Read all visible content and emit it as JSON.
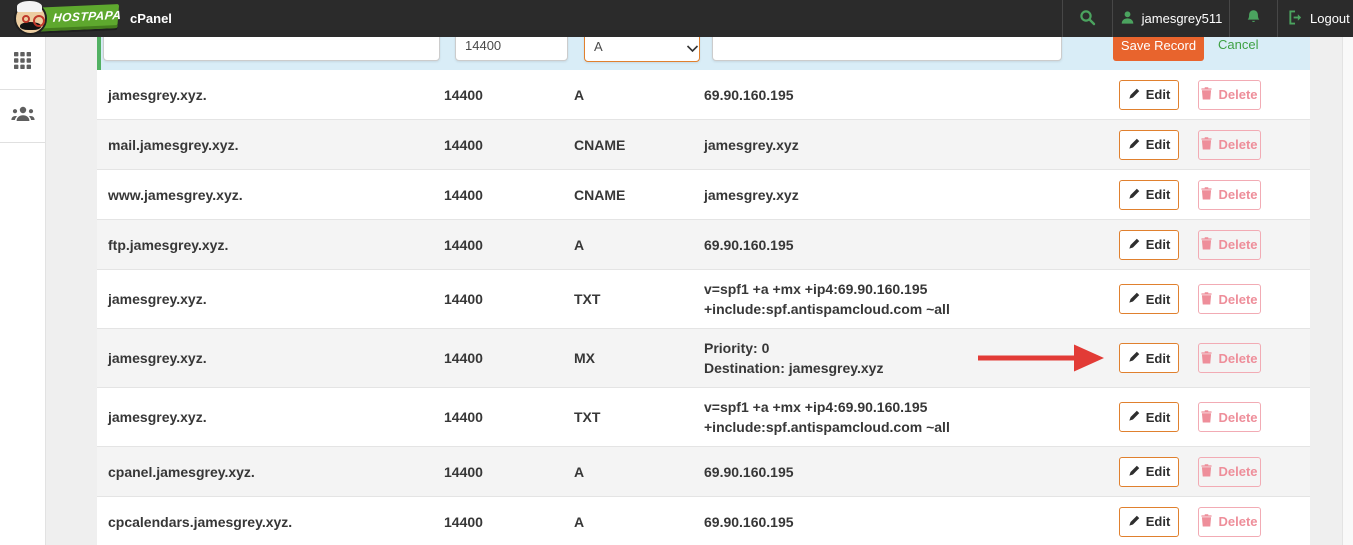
{
  "navbar": {
    "brand": "HOSTPAPA",
    "app_title": "cPanel",
    "username": "jamesgrey511",
    "logout_label": "Logout"
  },
  "edit_form": {
    "name_value": "",
    "ttl_value": "14400",
    "type_selected": "A",
    "record_value": "",
    "save_label": "Save Record",
    "cancel_label": "Cancel"
  },
  "table": {
    "edit_label": "Edit",
    "delete_label": "Delete",
    "rows": [
      {
        "name": "jamesgrey.xyz.",
        "ttl": "14400",
        "type": "A",
        "value": "69.90.160.195"
      },
      {
        "name": "mail.jamesgrey.xyz.",
        "ttl": "14400",
        "type": "CNAME",
        "value": "jamesgrey.xyz"
      },
      {
        "name": "www.jamesgrey.xyz.",
        "ttl": "14400",
        "type": "CNAME",
        "value": "jamesgrey.xyz"
      },
      {
        "name": "ftp.jamesgrey.xyz.",
        "ttl": "14400",
        "type": "A",
        "value": "69.90.160.195"
      },
      {
        "name": "jamesgrey.xyz.",
        "ttl": "14400",
        "type": "TXT",
        "value": "v=spf1 +a +mx +ip4:69.90.160.195 +include:spf.antispamcloud.com ~all"
      },
      {
        "name": "jamesgrey.xyz.",
        "ttl": "14400",
        "type": "MX",
        "value": "Priority: 0\nDestination: jamesgrey.xyz"
      },
      {
        "name": "jamesgrey.xyz.",
        "ttl": "14400",
        "type": "TXT",
        "value": "v=spf1 +a +mx +ip4:69.90.160.195 +include:spf.antispamcloud.com ~all"
      },
      {
        "name": "cpanel.jamesgrey.xyz.",
        "ttl": "14400",
        "type": "A",
        "value": "69.90.160.195"
      },
      {
        "name": "cpcalendars.jamesgrey.xyz.",
        "ttl": "14400",
        "type": "A",
        "value": "69.90.160.195"
      }
    ]
  },
  "annotation": {
    "arrow_row_index": 5,
    "arrow_target": "mx-row-edit-button",
    "arrow_color": "#e23b36"
  },
  "colors": {
    "navbar_bg": "#2b2b2b",
    "nav_icon_green": "#4ba35f",
    "logo_green": "#5ea82e",
    "edit_row_bg": "#d9edf7",
    "edit_row_border_green": "#52b163",
    "save_button_orange": "#e8642d",
    "focus_border_orange": "#e0802e",
    "cancel_green": "#3fa144",
    "delete_pink": "#ee8e9a",
    "page_bg": "#efefef"
  }
}
